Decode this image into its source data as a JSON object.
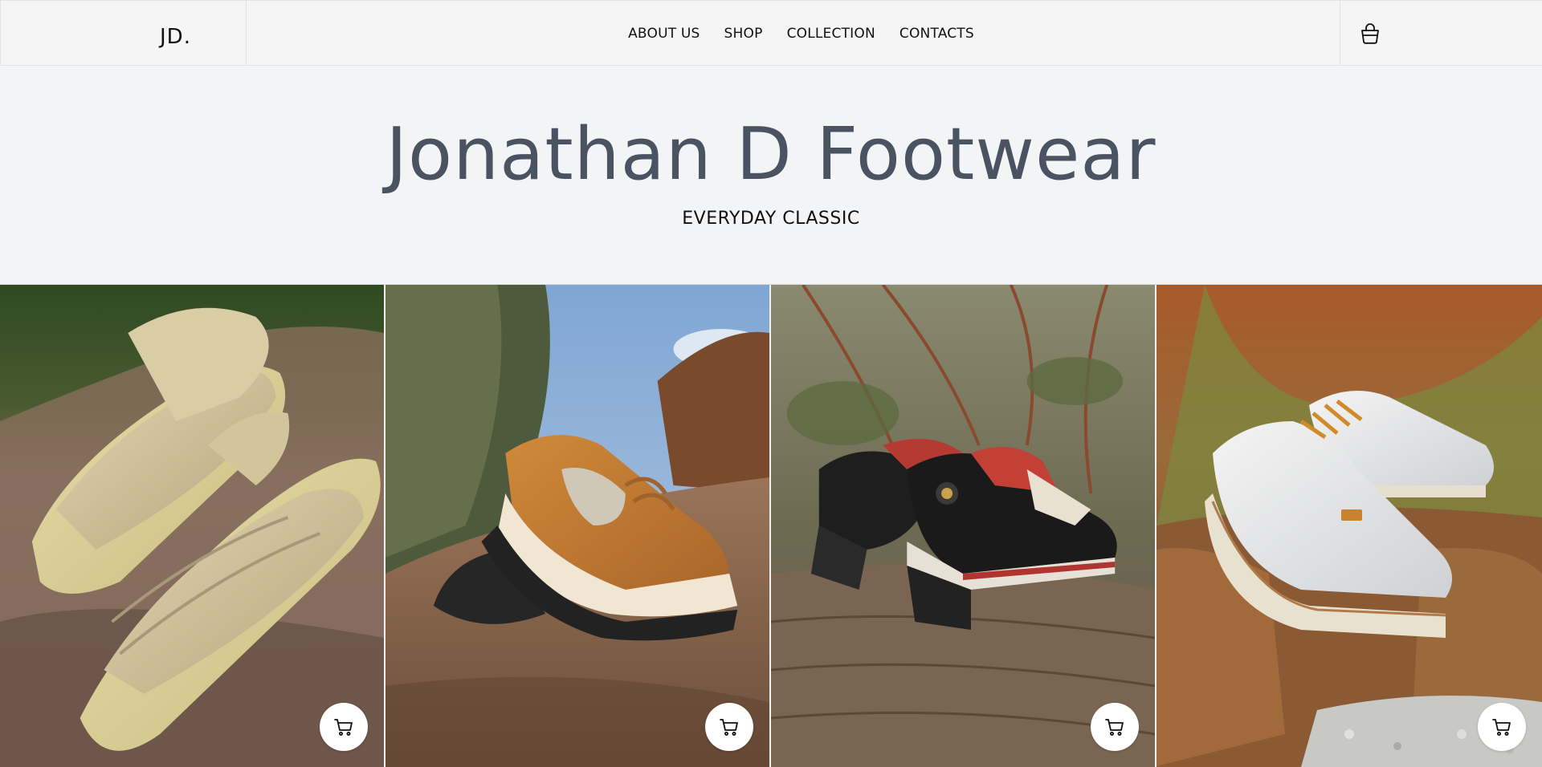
{
  "brand": {
    "logo": "JD."
  },
  "nav": {
    "items": [
      {
        "label": "ABOUT US"
      },
      {
        "label": "SHOP"
      },
      {
        "label": "COLLECTION"
      },
      {
        "label": "CONTACTS"
      }
    ],
    "cart_icon": "shopping-bag-icon"
  },
  "hero": {
    "title": "Jonathan D Footwear",
    "subtitle": "EVERYDAY CLASSIC"
  },
  "products": [
    {
      "image": "beige puffy sandal on rock",
      "cart_icon": "shopping-cart-icon"
    },
    {
      "image": "tan suede sneaker on rock",
      "cart_icon": "shopping-cart-icon"
    },
    {
      "image": "black and red sneakers on wood",
      "cart_icon": "shopping-cart-icon"
    },
    {
      "image": "white leather lace-up shoe on rock",
      "cart_icon": "shopping-cart-icon"
    }
  ],
  "colors": {
    "background": "#f3f4f6",
    "title": "#4a5362",
    "text": "#111111"
  }
}
